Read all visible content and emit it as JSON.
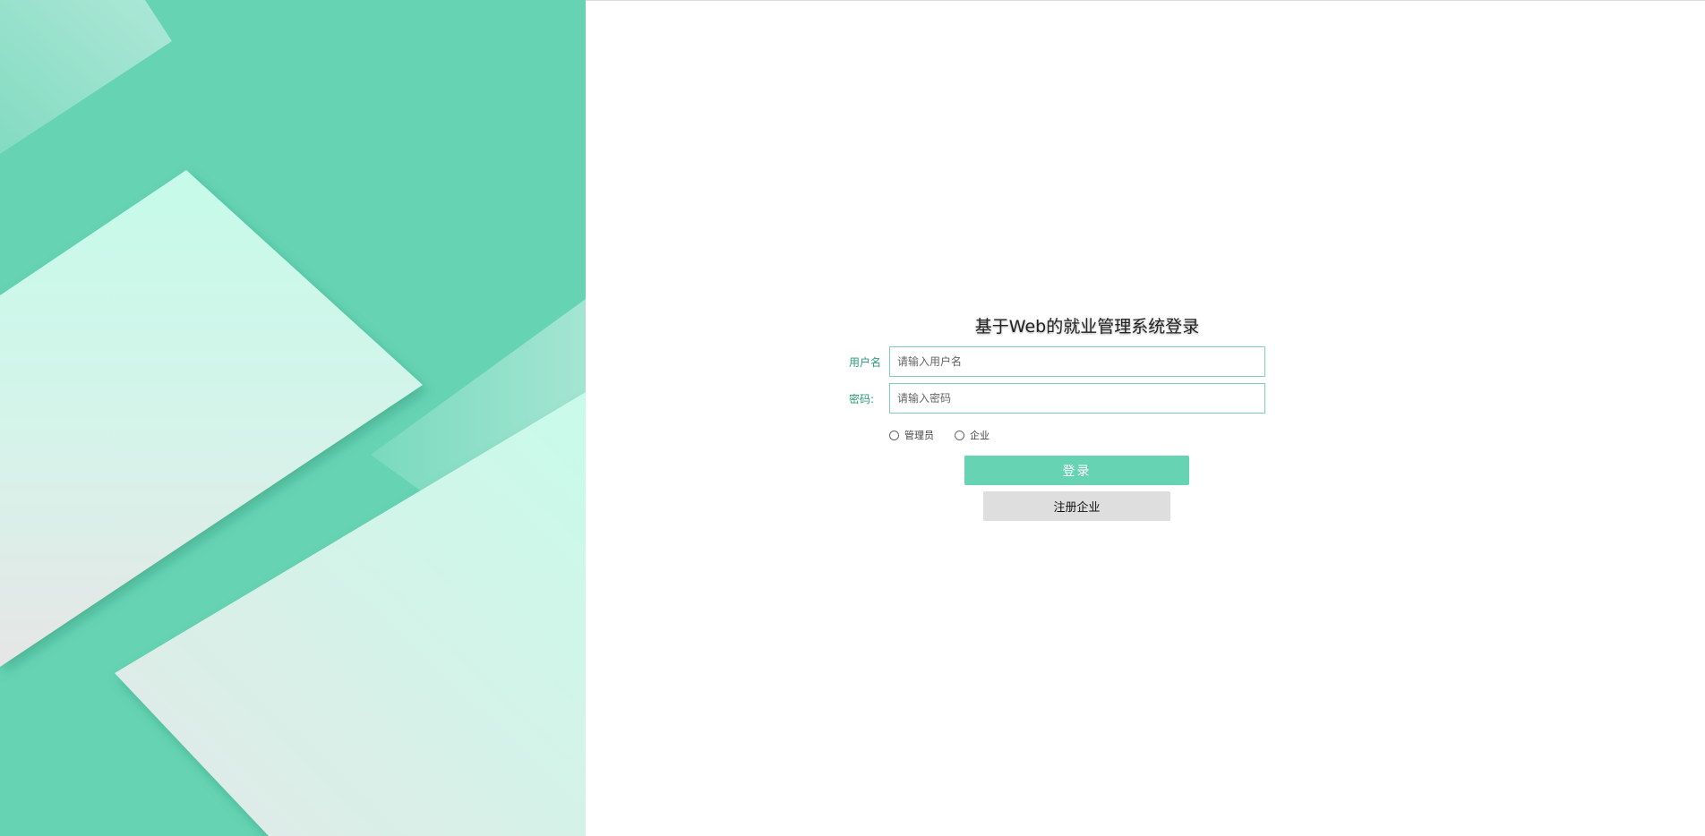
{
  "login": {
    "title": "基于Web的就业管理系统登录",
    "username_label": "用户名",
    "username_placeholder": "请输入用户名",
    "username_value": "",
    "password_label": "密码:",
    "password_placeholder": "请输入密码",
    "password_value": "",
    "roles": [
      {
        "label": "管理员",
        "selected": false
      },
      {
        "label": "企业",
        "selected": false
      }
    ],
    "login_button": "登录",
    "register_button": "注册企业"
  },
  "colors": {
    "accent": "#66d3b2",
    "label": "#2e9a7a",
    "register_bg": "#dedede"
  }
}
